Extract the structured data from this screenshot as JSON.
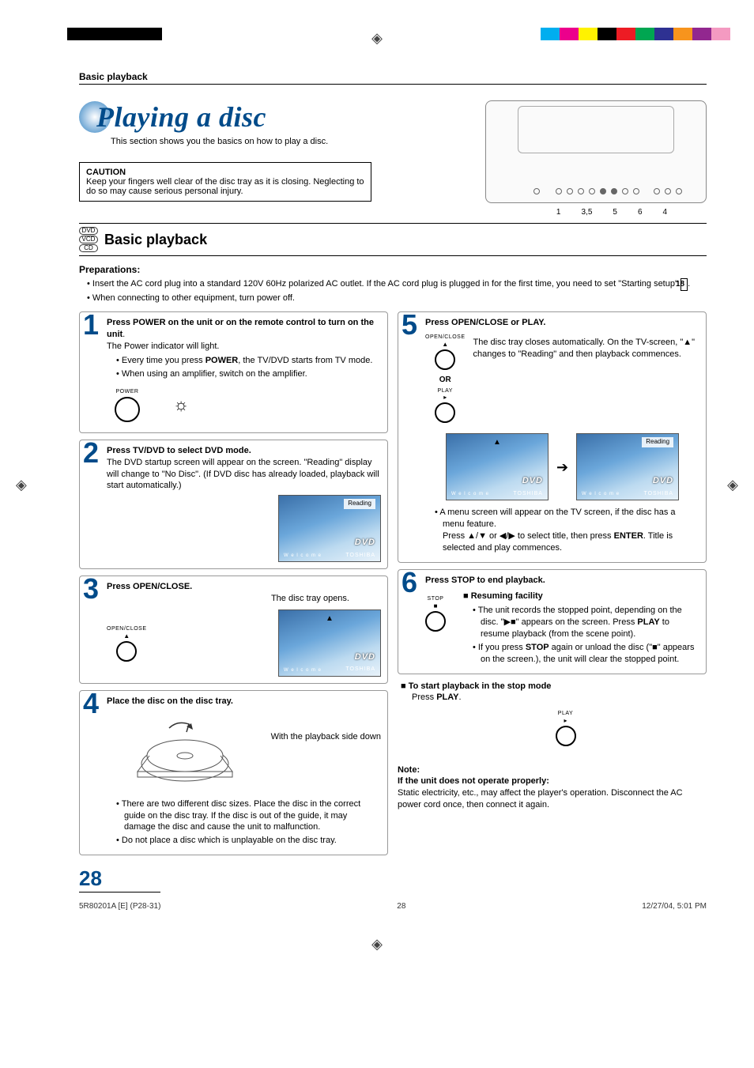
{
  "header": {
    "section_label": "Basic playback"
  },
  "title": {
    "text": "Playing a disc",
    "subtitle": "This section shows you the basics on how to play a disc."
  },
  "device_callouts": [
    "1",
    "3,5",
    "5",
    "6",
    "4"
  ],
  "caution": {
    "heading": "CAUTION",
    "body": "Keep your fingers well clear of the disc tray as it is closing. Neglecting to do so may cause serious personal injury."
  },
  "section_heading": {
    "icons": [
      "DVD",
      "VCD",
      "CD"
    ],
    "title": "Basic playback"
  },
  "preparations": {
    "label": "Preparations:",
    "items": [
      "Insert the AC cord plug into a standard 120V 60Hz polarized AC outlet. If the AC cord plug is plugged in for the first time, you need to set \"Starting setup\"",
      "When connecting to other equipment, turn power off."
    ],
    "ref_page": "18"
  },
  "steps": {
    "s1": {
      "num": "1",
      "head_a": "Press POWER on the unit or on the remote control to turn on the unit",
      "line1": "The Power indicator will light.",
      "b1_pre": "Every time you press ",
      "b1_bold": "POWER",
      "b1_post": ", the TV/DVD starts from TV mode.",
      "b2": "When using an amplifier, switch on the amplifier.",
      "btn_label": "POWER"
    },
    "s2": {
      "num": "2",
      "head": "Press TV/DVD to select DVD mode.",
      "body": "The DVD startup screen will appear on the screen. \"Reading\" display will change to \"No Disc\". (If DVD disc has already loaded, playback will start automatically.)",
      "screen_reading": "Reading",
      "screen_logo": "DVD",
      "screen_brand": "TOSHIBA",
      "screen_welcome": "W e l c o m e"
    },
    "s3": {
      "num": "3",
      "head": "Press OPEN/CLOSE.",
      "body": "The disc tray opens.",
      "btn_label": "OPEN/CLOSE",
      "eject_sym": "▲"
    },
    "s4": {
      "num": "4",
      "head": "Place the disc on the disc tray.",
      "side_note": "With the playback side down",
      "b1": "There are two different disc sizes. Place the disc in the correct guide on the disc tray. If the disc is out of the guide, it may damage the disc and cause the unit to malfunction.",
      "b2": "Do not place a disc which is unplayable on the disc tray."
    },
    "s5": {
      "num": "5",
      "head": "Press OPEN/CLOSE or PLAY.",
      "btn1_label": "OPEN/CLOSE",
      "btn1_sym": "▲",
      "or": "OR",
      "btn2_label": "PLAY",
      "btn2_sym": "▸",
      "body": "The disc tray closes automatically. On the TV-screen, \"▲\" changes to \"Reading\" and then playback commences.",
      "menu_note_1": "A menu screen will appear on the TV screen, if the disc has a menu feature.",
      "menu_note_2_pre": "Press ▲/▼ or ◀/▶ to select title, then press ",
      "menu_note_2_bold": "ENTER",
      "menu_note_2_post": ". Title is selected and play commences."
    },
    "s6": {
      "num": "6",
      "head": "Press STOP to end playback.",
      "btn_label": "STOP",
      "btn_sym": "■",
      "resume_head": "Resuming facility",
      "r1_pre": "The unit records the stopped point, depending on the disc. \"▶■\" appears on the screen. Press ",
      "r1_bold": "PLAY",
      "r1_post": " to resume playback (from the scene point).",
      "r2_pre": "If you press ",
      "r2_bold": "STOP",
      "r2_post": " again or unload the disc (\"■\" appears on the screen.), the unit will clear the stopped point."
    }
  },
  "stop_mode": {
    "head": "To start playback in the stop mode",
    "body_pre": "Press ",
    "body_bold": "PLAY",
    "body_post": ".",
    "btn_label": "PLAY",
    "btn_sym": "▸"
  },
  "note": {
    "label": "Note:",
    "head": "If the unit does not operate properly:",
    "body": "Static electricity, etc., may affect the player's operation. Disconnect the AC power cord once, then connect it again."
  },
  "footer": {
    "page_num": "28",
    "doc_id": "5R80201A [E] (P28-31)",
    "center": "28",
    "right": "12/27/04, 5:01 PM"
  }
}
